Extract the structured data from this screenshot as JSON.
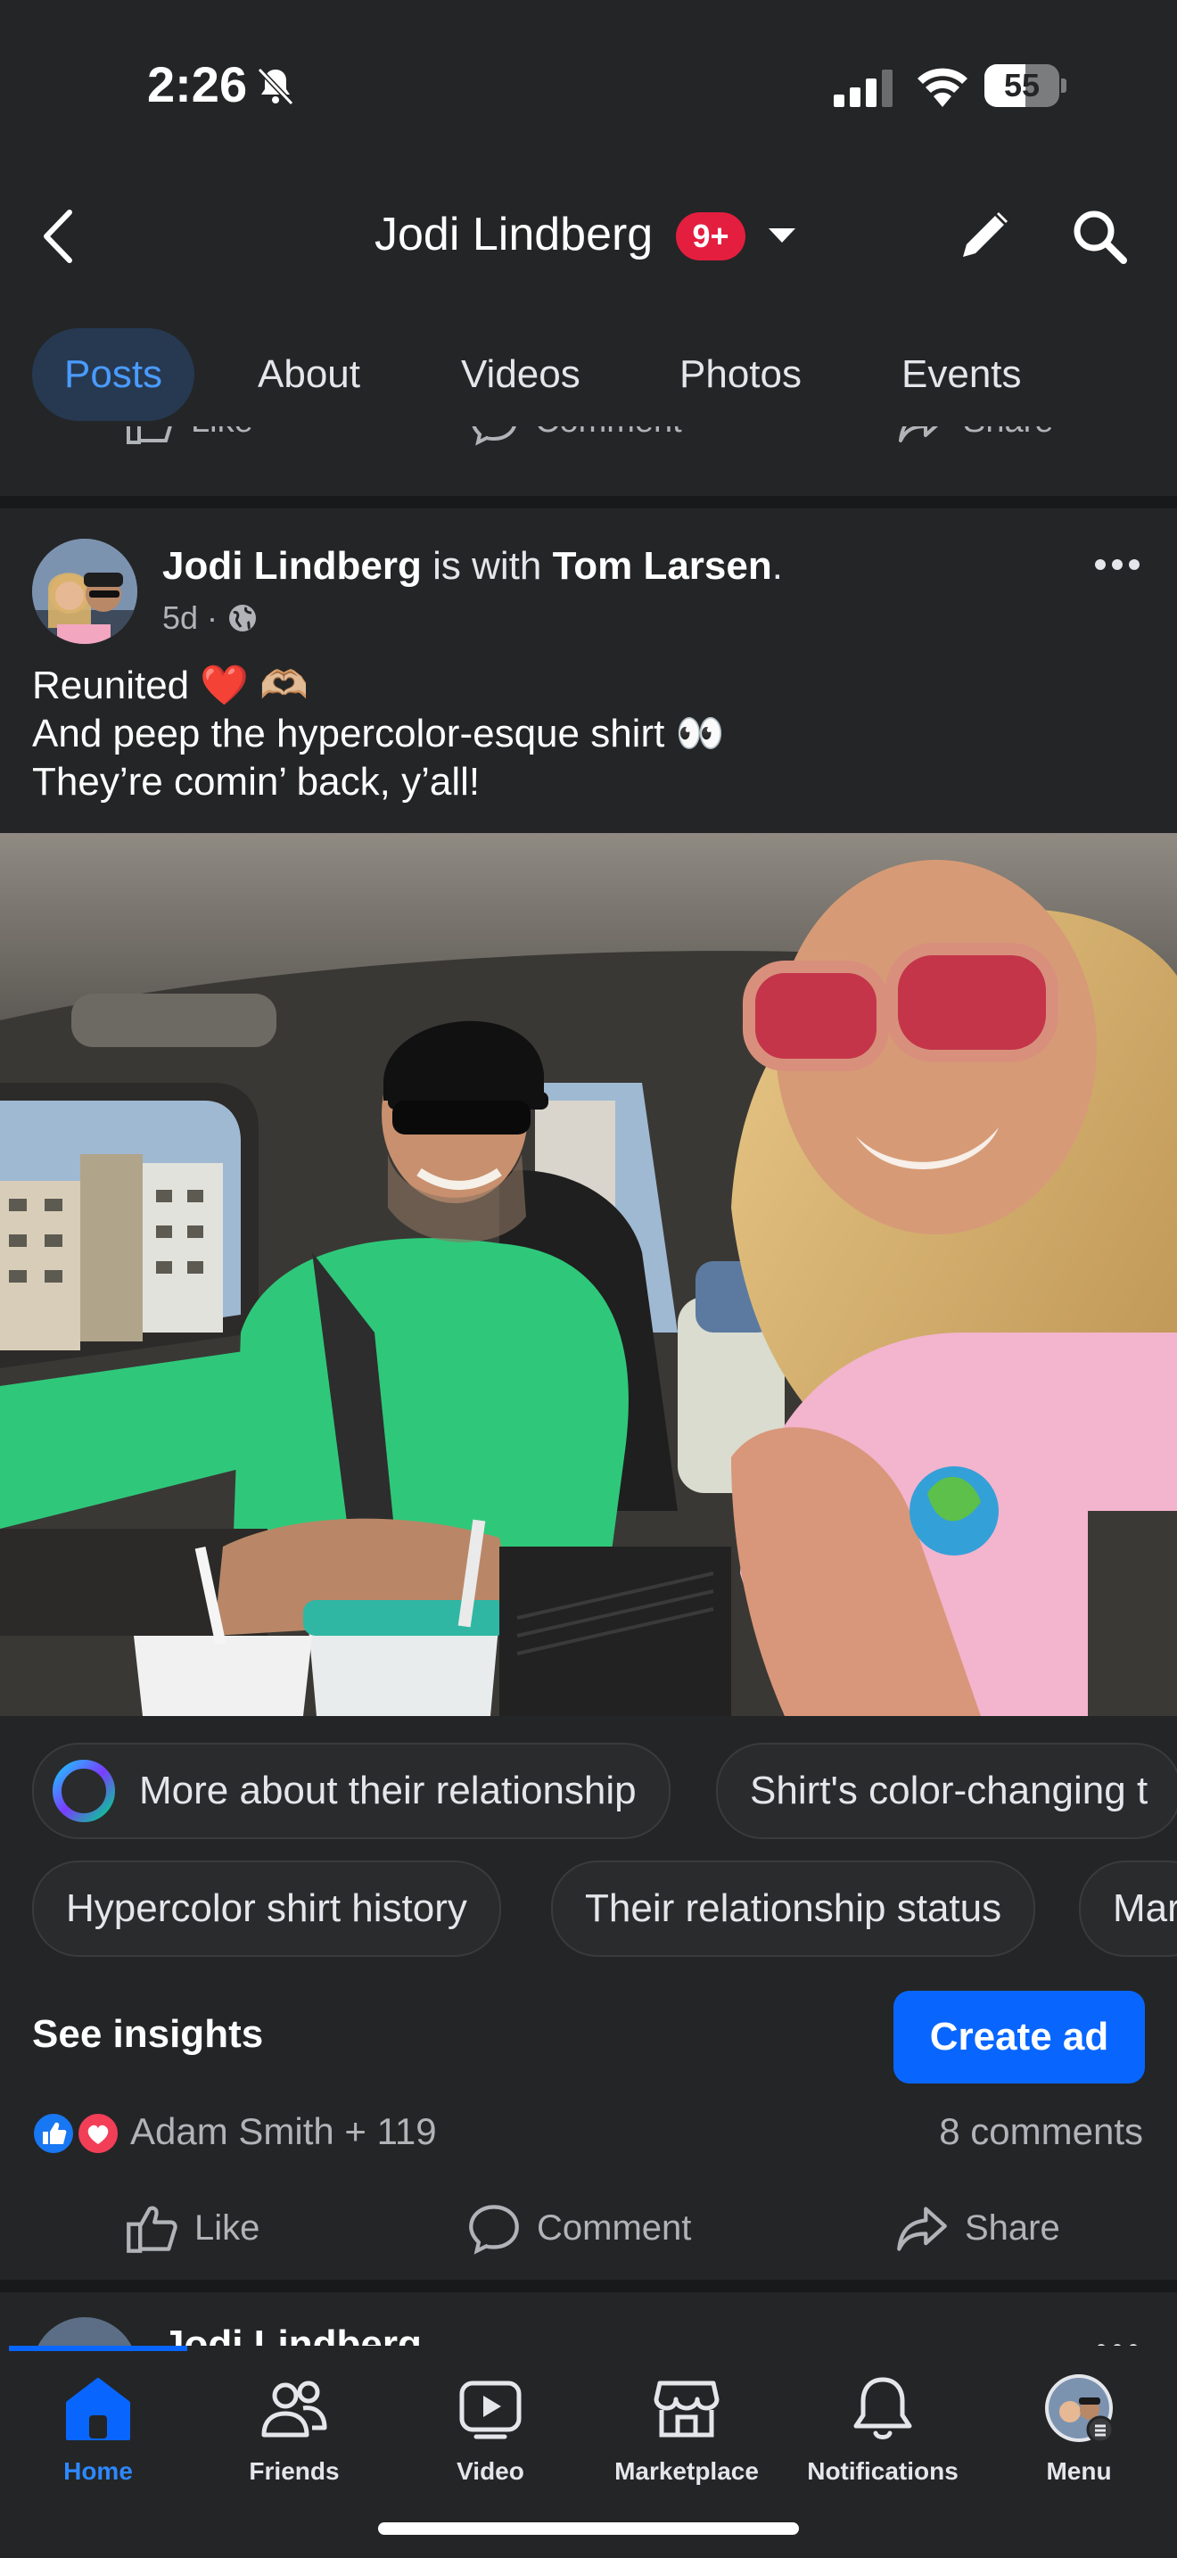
{
  "status_bar": {
    "time": "2:26",
    "battery": "55"
  },
  "header": {
    "title": "Jodi Lindberg",
    "badge": "9+"
  },
  "tabs": [
    {
      "label": "Posts",
      "active": true
    },
    {
      "label": "About"
    },
    {
      "label": "Videos"
    },
    {
      "label": "Photos"
    },
    {
      "label": "Events"
    }
  ],
  "prev_post_actions": {
    "like": "Like",
    "comment": "Comment",
    "share": "Share"
  },
  "post": {
    "author": "Jodi Lindberg",
    "with_text": "is with",
    "tagged": "Tom Larsen",
    "period": ".",
    "time": "5d",
    "caption_lines": [
      "Reunited ❤️ 🫶🏼",
      "And peep the hypercolor-esque shirt 👀",
      "They’re comin’ back, y’all!"
    ],
    "chips_row1": [
      "More about their relationship",
      "Shirt's color-changing t"
    ],
    "chips_row2": [
      "Hypercolor shirt history",
      "Their relationship status",
      "Mar"
    ],
    "insights": "See insights",
    "create_ad": "Create ad",
    "reactors": "Adam Smith + 119",
    "comments": "8 comments",
    "actions": {
      "like": "Like",
      "comment": "Comment",
      "share": "Share"
    }
  },
  "next_post_author": "Jodi Lindberg",
  "bottom_nav": [
    {
      "label": "Home",
      "icon": "home-icon",
      "active": true
    },
    {
      "label": "Friends",
      "icon": "friends-icon"
    },
    {
      "label": "Video",
      "icon": "video-icon"
    },
    {
      "label": "Marketplace",
      "icon": "marketplace-icon"
    },
    {
      "label": "Notifications",
      "icon": "bell-icon"
    },
    {
      "label": "Menu",
      "icon": "profile-avatar"
    }
  ],
  "colors": {
    "accent": "#0866ff",
    "badge": "#e41e3f",
    "background": "#242526",
    "active_tab_text": "#4a9bff"
  }
}
